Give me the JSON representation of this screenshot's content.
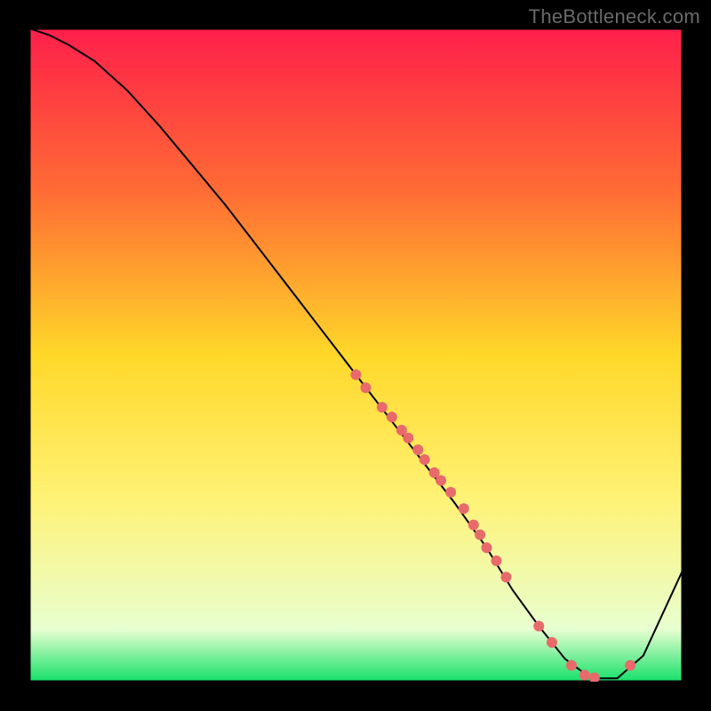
{
  "watermark": "TheBottleneck.com",
  "chart_data": {
    "type": "line",
    "title": "",
    "xlabel": "",
    "ylabel": "",
    "xlim": [
      0,
      100
    ],
    "ylim": [
      0,
      100
    ],
    "grid": false,
    "legend": false,
    "gradient_stops": [
      {
        "offset": 0,
        "color": "#ff1f4b"
      },
      {
        "offset": 25,
        "color": "#ff6c34"
      },
      {
        "offset": 50,
        "color": "#ffd829"
      },
      {
        "offset": 72,
        "color": "#fff276"
      },
      {
        "offset": 92,
        "color": "#e8ffd0"
      },
      {
        "offset": 100,
        "color": "#14e06a"
      }
    ],
    "series": [
      {
        "name": "bottleneck-curve",
        "type": "line",
        "color": "#000000",
        "stroke_width": 2,
        "x": [
          0,
          3,
          6,
          10,
          15,
          20,
          25,
          30,
          35,
          40,
          45,
          50,
          55,
          60,
          65,
          70,
          74,
          78,
          82,
          86,
          90,
          94,
          100
        ],
        "y": [
          100,
          99,
          97.5,
          95,
          90.5,
          85,
          79,
          73,
          66.5,
          60,
          53.5,
          47,
          40.5,
          34,
          27.5,
          20.5,
          14,
          8.5,
          3.5,
          0.5,
          0.5,
          4,
          17
        ]
      },
      {
        "name": "highlight-points",
        "type": "scatter",
        "color": "#e86a6a",
        "radius": 6,
        "x": [
          50,
          51.5,
          54,
          55.5,
          57,
          58,
          59.5,
          60.5,
          62,
          63,
          64.5,
          66.5,
          68,
          69,
          70,
          71.5,
          73,
          78,
          80,
          83,
          85,
          86.5,
          92
        ],
        "y": [
          47,
          45,
          42,
          40.5,
          38.5,
          37.3,
          35.5,
          34,
          32,
          30.8,
          29,
          26.5,
          24,
          22.5,
          20.5,
          18.5,
          16,
          8.5,
          6,
          2.5,
          1,
          0.6,
          2.5
        ]
      }
    ]
  }
}
